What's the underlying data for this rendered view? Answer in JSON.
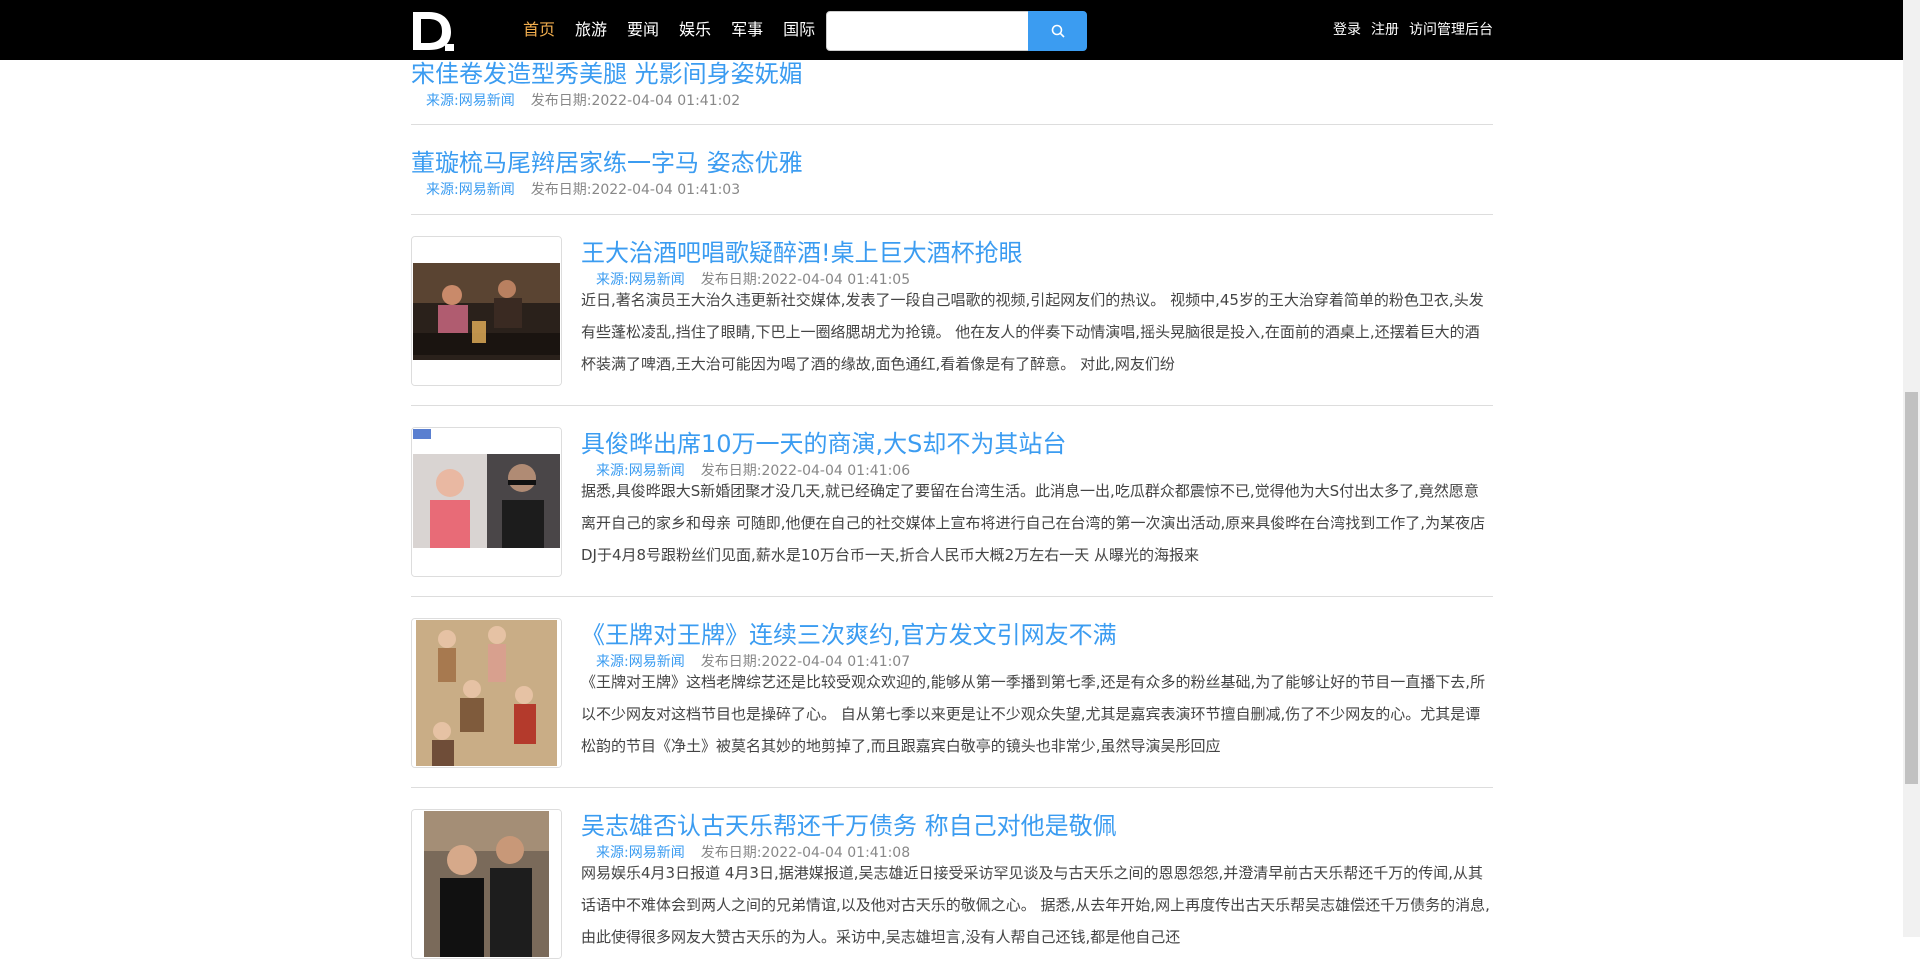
{
  "nav": {
    "links": [
      "首页",
      "旅游",
      "要闻",
      "娱乐",
      "军事",
      "国际"
    ],
    "search": {
      "value": "",
      "placeholder": ""
    },
    "right": [
      "登录",
      "注册",
      "访问管理后台"
    ]
  },
  "meta_labels": {
    "source": "来源:",
    "date": "发布日期:"
  },
  "articles": [
    {
      "title": "宋佳卷发造型秀美腿 光影间身姿妩媚",
      "source": "网易新闻",
      "date": "2022-04-04 01:41:02"
    },
    {
      "title": "董璇梳马尾辫居家练一字马 姿态优雅",
      "source": "网易新闻",
      "date": "2022-04-04 01:41:03"
    },
    {
      "title": "王大治酒吧唱歌疑醉酒!桌上巨大酒杯抢眼",
      "source": "网易新闻",
      "date": "2022-04-04 01:41:05",
      "summary": "近日,著名演员王大治久违更新社交媒体,发表了一段自己唱歌的视频,引起网友们的热议。 视频中,45岁的王大治穿着简单的粉色卫衣,头发有些蓬松凌乱,挡住了眼睛,下巴上一圈络腮胡尤为抢镜。 他在友人的伴奏下动情演唱,摇头晃脑很是投入,在面前的酒桌上,还摆着巨大的酒杯装满了啤酒,王大治可能因为喝了酒的缘故,面色通红,看着像是有了醉意。 对此,网友们纷"
    },
    {
      "title": "具俊晔出席10万一天的商演,大S却不为其站台",
      "source": "网易新闻",
      "date": "2022-04-04 01:41:06",
      "summary": "据悉,具俊晔跟大S新婚团聚才没几天,就已经确定了要留在台湾生活。此消息一出,吃瓜群众都震惊不已,觉得他为大S付出太多了,竟然愿意离开自己的家乡和母亲 可随即,他便在自己的社交媒体上宣布将进行自己在台湾的第一次演出活动,原来具俊晔在台湾找到工作了,为某夜店DJ于4月8号跟粉丝们见面,薪水是10万台币一天,折合人民币大概2万左右一天 从曝光的海报来"
    },
    {
      "title": "《王牌对王牌》连续三次爽约,官方发文引网友不满",
      "source": "网易新闻",
      "date": "2022-04-04 01:41:07",
      "summary": "《王牌对王牌》这档老牌综艺还是比较受观众欢迎的,能够从第一季播到第七季,还是有众多的粉丝基础,为了能够让好的节目一直播下去,所以不少网友对这档节目也是操碎了心。 自从第七季以来更是让不少观众失望,尤其是嘉宾表演环节擅自删减,伤了不少网友的心。尤其是谭松韵的节目《净土》被莫名其妙的地剪掉了,而且跟嘉宾白敬亭的镜头也非常少,虽然导演吴彤回应"
    },
    {
      "title": "吴志雄否认古天乐帮还千万债务 称自己对他是敬佩",
      "source": "网易新闻",
      "date": "2022-04-04 01:41:08",
      "summary": "网易娱乐4月3日报道 4月3日,据港媒报道,吴志雄近日接受采访罕见谈及与古天乐之间的恩恩怨怨,并澄清早前古天乐帮还千万的传闻,从其话语中不难体会到两人之间的兄弟情谊,以及他对古天乐的敬佩之心。 据悉,从去年开始,网上再度传出古天乐帮吴志雄偿还千万债务的消息,由此使得很多网友大赞古天乐的为人。采访中,吴志雄坦言,没有人帮自己还钱,都是他自己还"
    }
  ],
  "colors": {
    "accent": "#3b9cf1",
    "nav_bg": "#000000",
    "active": "#f0ad4e"
  }
}
